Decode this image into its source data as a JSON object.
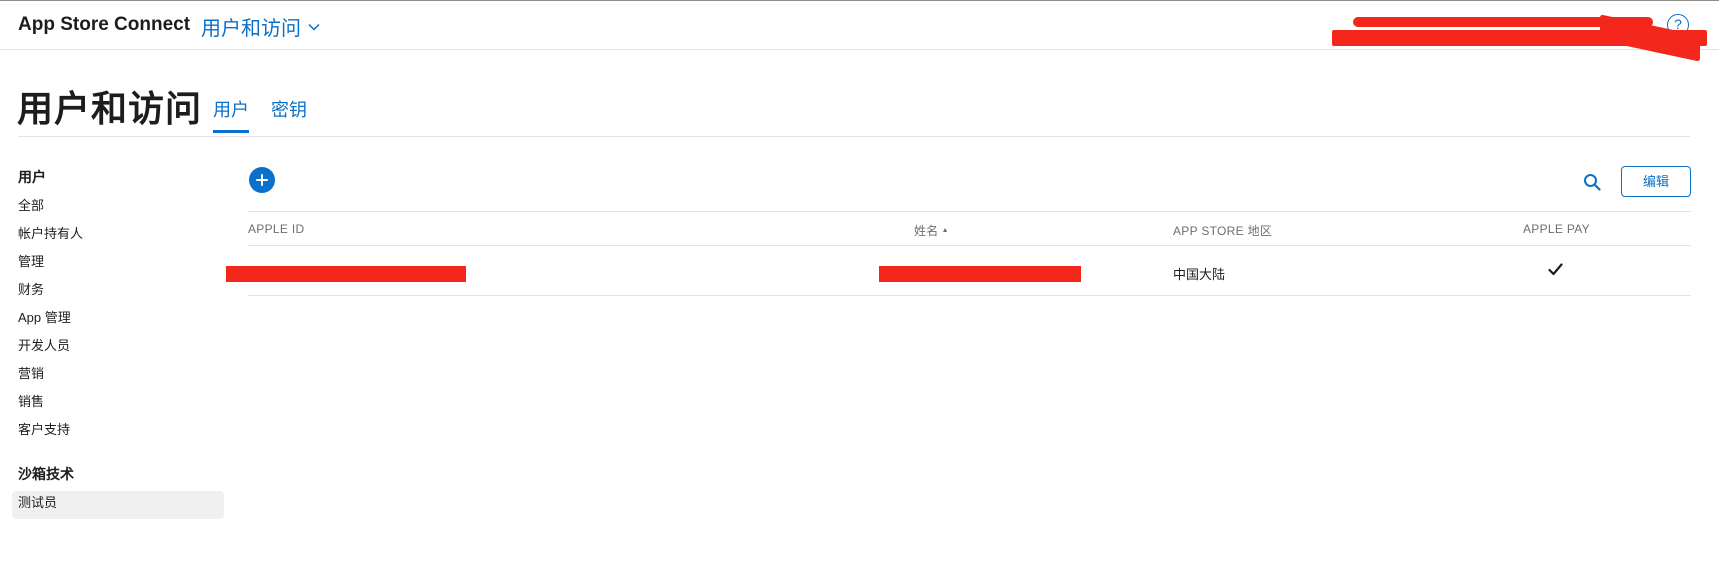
{
  "topbar": {
    "app_name": "App Store Connect",
    "section_switch_label": "用户和访问",
    "help_icon": "help-icon"
  },
  "page": {
    "title": "用户和访问",
    "tabs": [
      {
        "label": "用户",
        "active": true
      },
      {
        "label": "密钥",
        "active": false
      }
    ]
  },
  "sidebar": {
    "groups": [
      {
        "heading": "用户",
        "items": [
          "全部",
          "帐户持有人",
          "管理",
          "财务",
          "App 管理",
          "开发人员",
          "营销",
          "销售",
          "客户支持"
        ]
      },
      {
        "heading": "沙箱技术",
        "items": [
          "测试员"
        ],
        "selected": "测试员"
      }
    ]
  },
  "toolbar": {
    "add_icon": "plus-circle-icon",
    "search_icon": "search-icon",
    "edit_label": "编辑"
  },
  "table": {
    "columns": [
      {
        "label": "APPLE ID",
        "sortable": false
      },
      {
        "label": "姓名",
        "sortable": true,
        "sort": "ascending"
      },
      {
        "label": "APP STORE 地区",
        "sortable": false
      },
      {
        "label": "APPLE PAY",
        "sortable": false
      }
    ],
    "rows": [
      {
        "apple_id": "",
        "name": "",
        "region": "中国大陆",
        "apple_pay": true
      }
    ]
  },
  "colors": {
    "accent": "#0a70c9",
    "redaction": "#f3271c",
    "selected_bg": "#f0f0f0"
  }
}
